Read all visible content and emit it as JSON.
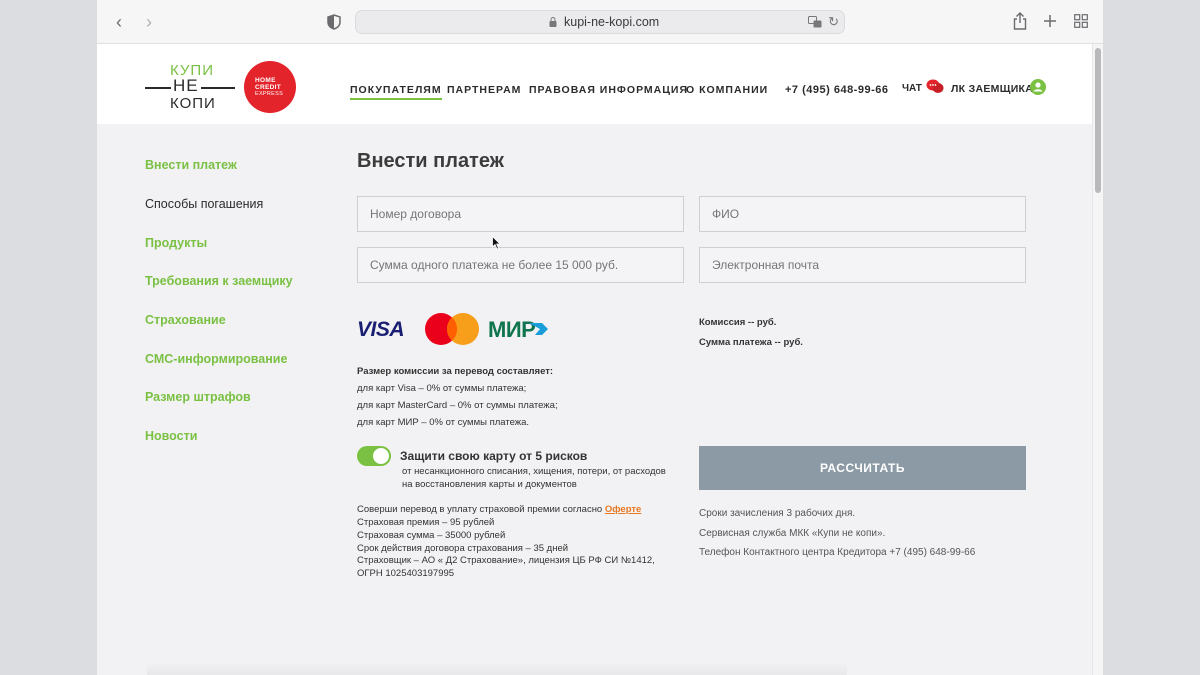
{
  "browser": {
    "url": "kupi-ne-kopi.com"
  },
  "header": {
    "logo_kupi": [
      "КУПИ",
      "НЕ",
      "КОПИ"
    ],
    "logo_hc": [
      "HOME",
      "CREDIT",
      "EXPRESS"
    ],
    "nav": [
      "ПОКУПАТЕЛЯМ",
      "ПАРТНЕРАМ",
      "ПРАВОВАЯ ИНФОРМАЦИЯ",
      "О КОМПАНИИ"
    ],
    "phone": "+7 (495) 648-99-66",
    "chat": "ЧАТ",
    "lk": "ЛК ЗАЕМЩИКА"
  },
  "sidebar": {
    "items": [
      {
        "label": "Внести платеж"
      },
      {
        "label": "Способы погашения"
      },
      {
        "label": "Продукты"
      },
      {
        "label": "Требования к заемщику"
      },
      {
        "label": "Страхование"
      },
      {
        "label": "СМС-информирование"
      },
      {
        "label": "Размер штрафов"
      },
      {
        "label": "Новости"
      }
    ]
  },
  "main": {
    "title": "Внести платеж",
    "fields": {
      "contract": "Номер договора",
      "fio": "ФИО",
      "amount": "Сумма одного платежа не более 15 000 руб.",
      "email": "Электронная почта"
    },
    "cards": {
      "visa": "VISA",
      "mir": "МИР"
    },
    "commission_title": "Размер комиссии за перевод составляет:",
    "commission_lines": [
      "для карт Visa – 0% от суммы платежа;",
      "для карт MasterCard – 0% от суммы платежа;",
      "для карт МИР – 0% от суммы платежа."
    ],
    "summary": {
      "commission": "Комиссия -- руб.",
      "total": "Сумма платежа -- руб."
    },
    "toggle": {
      "title": "Защити свою карту от 5 рисков",
      "desc1": "от несанкционного списания, хищения, потери, от расходов",
      "desc2": "на восстановления карты и документов"
    },
    "insurance": {
      "intro": "Соверши перевод в уплату страховой премии согласно",
      "offer": "Оферте",
      "lines": [
        "Страховая премия – 95 рублей",
        "Страховая сумма – 35000 рублей",
        "Срок действия договора страхования – 35 дней",
        "Страховщик – АО « Д2 Страхование», лицензия ЦБ РФ СИ №1412,",
        "ОГРН 1025403197995"
      ]
    },
    "calc_button": "РАССЧИТАТЬ",
    "info": [
      "Сроки зачисления 3 рабочих дня.",
      "Сервисная служба МКК «Купи не копи».",
      "Телефон Контактного центра Кредитора +7 (495) 648-99-66"
    ]
  }
}
